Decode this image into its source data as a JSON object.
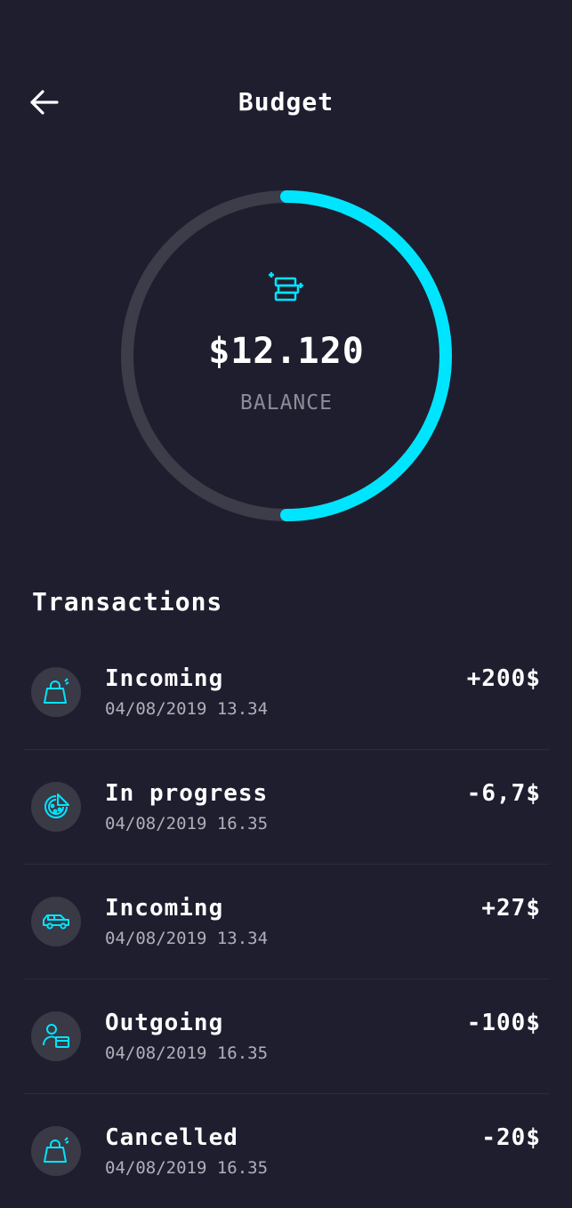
{
  "header": {
    "title": "Budget",
    "back_icon": "arrow-left-icon"
  },
  "balance": {
    "amount": "$12.120",
    "label": "BALANCE",
    "progress": 0.5,
    "icon": "wallet-stack-icon",
    "accent_color": "#00e5ff",
    "track_color": "#3d3c49"
  },
  "transactions": {
    "title": "Transactions",
    "items": [
      {
        "status": "Incoming",
        "datetime": "04/08/2019 13.34",
        "amount": "+200$",
        "icon": "shopping-bag-icon"
      },
      {
        "status": "In progress",
        "datetime": "04/08/2019 16.35",
        "amount": "-6,7$",
        "icon": "pizza-icon"
      },
      {
        "status": "Incoming",
        "datetime": "04/08/2019 13.34",
        "amount": "+27$",
        "icon": "car-icon"
      },
      {
        "status": "Outgoing",
        "datetime": "04/08/2019 16.35",
        "amount": "-100$",
        "icon": "person-card-icon"
      },
      {
        "status": "Cancelled",
        "datetime": "04/08/2019 16.35",
        "amount": "-20$",
        "icon": "shopping-bag-icon"
      }
    ]
  }
}
